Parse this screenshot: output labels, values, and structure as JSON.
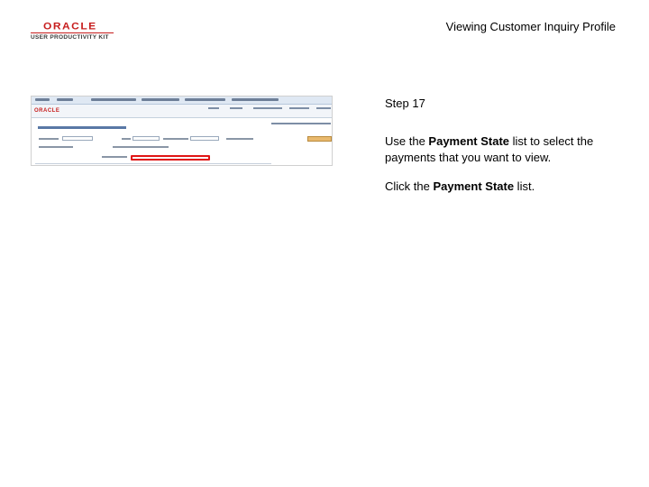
{
  "logo": {
    "brand": "ORACLE",
    "product": "USER PRODUCTIVITY KIT"
  },
  "doc_title": "Viewing Customer Inquiry Profile",
  "thumbnail": {
    "app_logo": "ORACLE",
    "page_heading": "Outstanding Customer Payments"
  },
  "step": {
    "label": "Step 17",
    "instruction": {
      "pre": "Use the ",
      "bold": "Payment State",
      "post": " list to select the payments that you want to view."
    },
    "action": {
      "pre": "Click the ",
      "bold": "Payment State",
      "post": " list."
    }
  },
  "colors": {
    "brand_red": "#c71d1d",
    "highlight": "#e01515"
  }
}
